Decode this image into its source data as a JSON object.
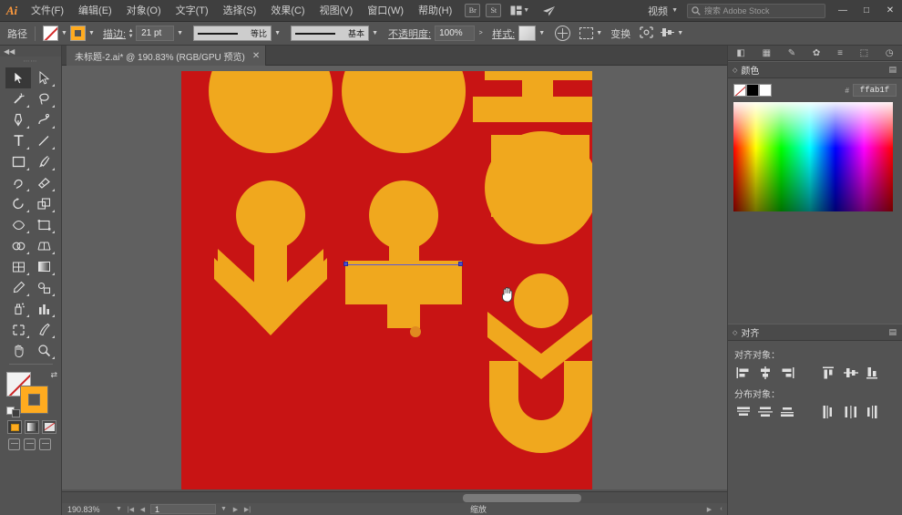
{
  "app": {
    "logo": "Ai",
    "menus": [
      {
        "label": "文件(F)"
      },
      {
        "label": "编辑(E)"
      },
      {
        "label": "对象(O)"
      },
      {
        "label": "文字(T)"
      },
      {
        "label": "选择(S)"
      },
      {
        "label": "效果(C)"
      },
      {
        "label": "视图(V)"
      },
      {
        "label": "窗口(W)"
      },
      {
        "label": "帮助(H)"
      }
    ],
    "bridge_button": "Br",
    "stock_button": "St",
    "workspace_label": "视频",
    "stock_search_placeholder": "搜索 Adobe Stock",
    "window_controls": {
      "minimize": "—",
      "maximize": "□",
      "close": "✕"
    }
  },
  "control_bar": {
    "object_label": "路径",
    "fill_label": "填色",
    "stroke_swatch_label": "描边颜色",
    "stroke_label": "描边:",
    "stroke_weight": "21 pt",
    "profile_label": "等比",
    "brush_label": "基本",
    "opacity_label": "不透明度:",
    "opacity_value": "100%",
    "style_label": "样式:",
    "transform_label": "变换",
    "arrow": ">"
  },
  "document": {
    "tab_title": "未标题-2.ai* @ 190.83% (RGB/GPU 预览)",
    "close_glyph": "✕"
  },
  "toolbar": {
    "collapse_glyph": "◀◀",
    "tools": [
      {
        "name": "selection-tool",
        "selected": true
      },
      {
        "name": "direct-selection-tool",
        "selected": false
      },
      {
        "name": "magic-wand-tool",
        "selected": false
      },
      {
        "name": "lasso-tool",
        "selected": false
      },
      {
        "name": "pen-tool",
        "selected": false
      },
      {
        "name": "curvature-tool",
        "selected": false
      },
      {
        "name": "type-tool",
        "selected": false
      },
      {
        "name": "line-segment-tool",
        "selected": false
      },
      {
        "name": "rectangle-tool",
        "selected": false
      },
      {
        "name": "paintbrush-tool",
        "selected": false
      },
      {
        "name": "shaper-tool",
        "selected": false
      },
      {
        "name": "eraser-tool",
        "selected": false
      },
      {
        "name": "rotate-tool",
        "selected": false
      },
      {
        "name": "scale-tool",
        "selected": false
      },
      {
        "name": "width-tool",
        "selected": false
      },
      {
        "name": "free-transform-tool",
        "selected": false
      },
      {
        "name": "shape-builder-tool",
        "selected": false
      },
      {
        "name": "perspective-grid-tool",
        "selected": false
      },
      {
        "name": "mesh-tool",
        "selected": false
      },
      {
        "name": "gradient-tool",
        "selected": false
      },
      {
        "name": "eyedropper-tool",
        "selected": false
      },
      {
        "name": "blend-tool",
        "selected": false
      },
      {
        "name": "symbol-sprayer-tool",
        "selected": false
      },
      {
        "name": "column-graph-tool",
        "selected": false
      },
      {
        "name": "artboard-tool",
        "selected": false
      },
      {
        "name": "slice-tool",
        "selected": false
      },
      {
        "name": "hand-tool",
        "selected": false
      },
      {
        "name": "zoom-tool",
        "selected": false
      }
    ],
    "fill_color": "none",
    "stroke_color": "#ffab1f",
    "swap_glyph": "⇄"
  },
  "canvas": {
    "artboard_background": "#c81414",
    "art_color": "#f0a81e",
    "cursor": "hand-cursor",
    "dot_color": "#e08a20"
  },
  "status_bar": {
    "zoom": "190.83%",
    "page": "1",
    "mode": "缩放",
    "first_glyph": "|◀",
    "prev_glyph": "◀",
    "next_glyph": "▶",
    "last_glyph": "▶|",
    "play_glyph": "▶",
    "chevron_glyph": "‹"
  },
  "panels": {
    "color": {
      "title": "颜色",
      "hex_prefix": "#",
      "hex_value": "ffab1f",
      "swatches": [
        "none",
        "#000000",
        "#ffffff"
      ]
    },
    "align": {
      "title": "对齐",
      "align_objects_label": "对齐对象：",
      "distribute_objects_label": "分布对象：",
      "align_buttons": [
        {
          "name": "align-left"
        },
        {
          "name": "align-horizontal-center"
        },
        {
          "name": "align-right"
        },
        {
          "name": "align-top"
        },
        {
          "name": "align-vertical-center"
        },
        {
          "name": "align-bottom"
        }
      ],
      "distribute_buttons": [
        {
          "name": "distribute-top"
        },
        {
          "name": "distribute-vertical-center"
        },
        {
          "name": "distribute-bottom"
        },
        {
          "name": "distribute-left"
        },
        {
          "name": "distribute-horizontal-center"
        },
        {
          "name": "distribute-right"
        }
      ]
    }
  }
}
